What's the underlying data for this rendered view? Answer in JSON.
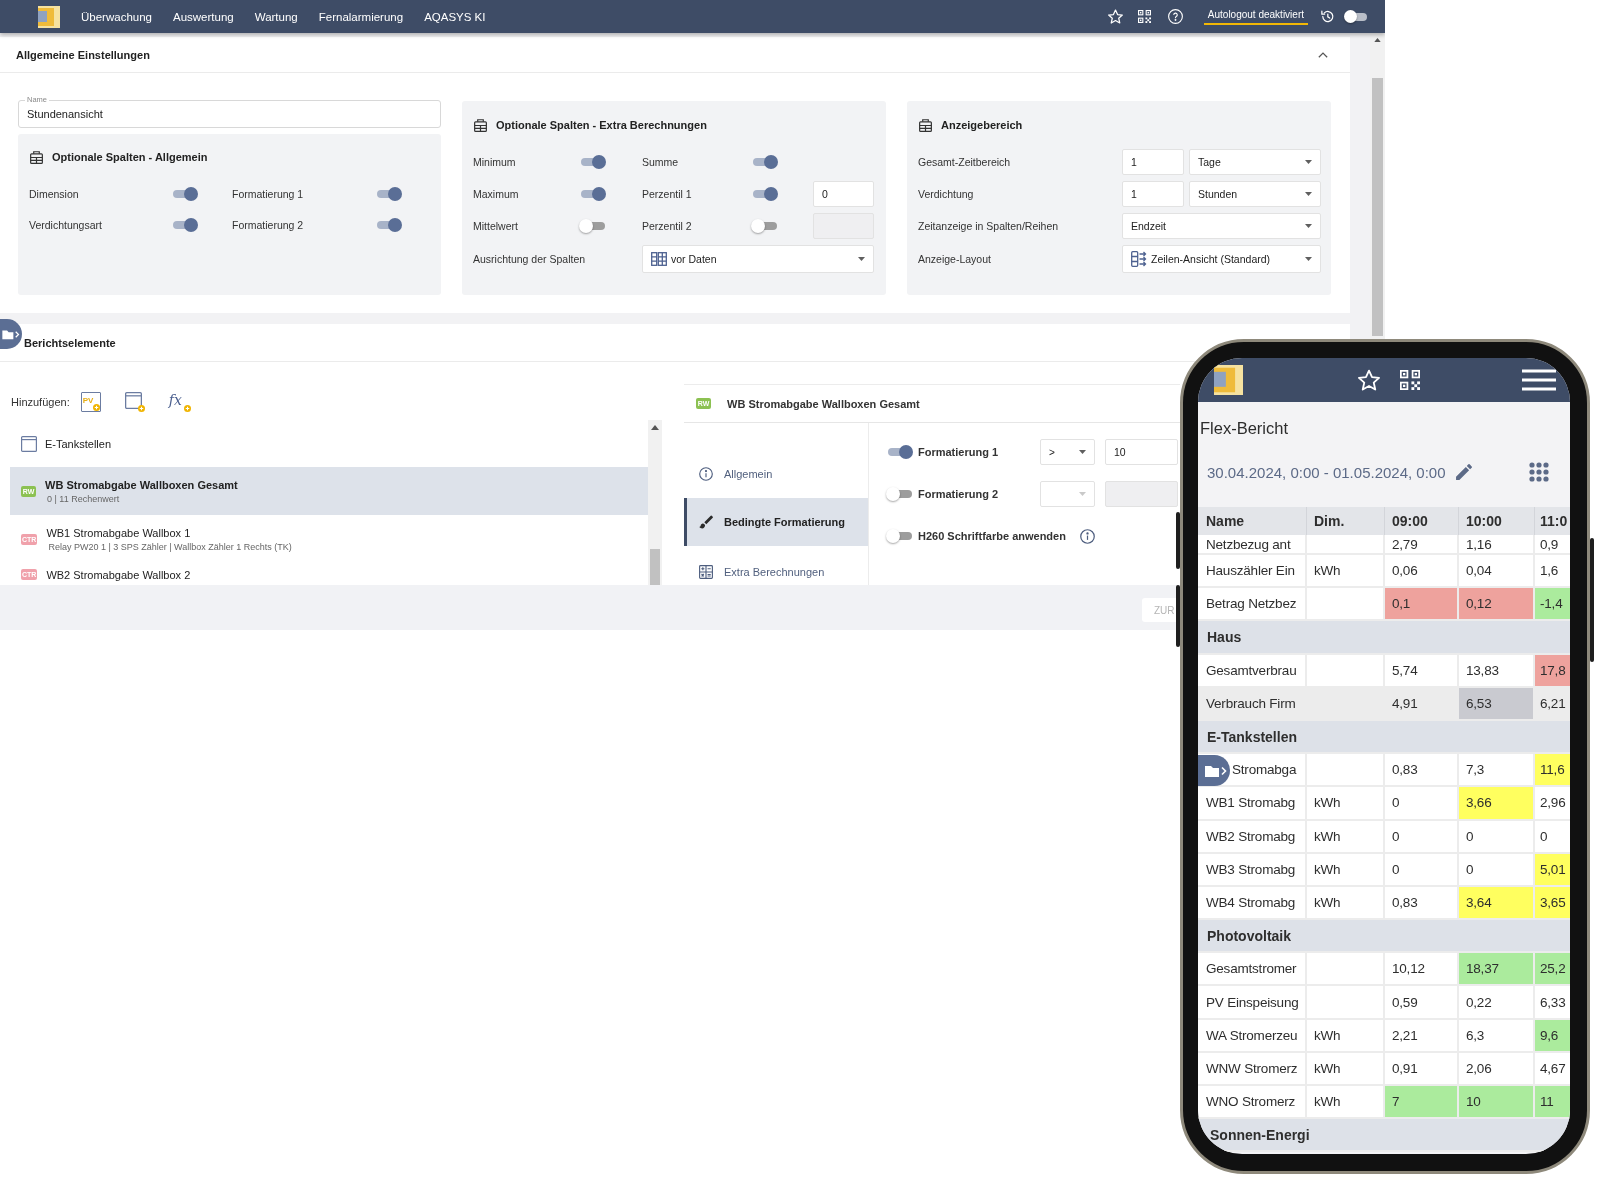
{
  "top_bar": {
    "nav": [
      "Überwachung",
      "Auswertung",
      "Wartung",
      "Fernalarmierung",
      "AQASYS KI"
    ],
    "autologout_label": "Autologout deaktiviert",
    "toggle_on": false
  },
  "general_settings": {
    "title": "Allgemeine Einstellungen",
    "expanded": true,
    "name_field": {
      "label": "Name",
      "value": "Stundenansicht"
    },
    "columns_panel": {
      "title": "Optionale Spalten - Allgemein",
      "toggles": [
        {
          "label": "Dimension",
          "on": true
        },
        {
          "label": "Formatierung 1",
          "on": true
        },
        {
          "label": "Verdichtungsart",
          "on": true
        },
        {
          "label": "Formatierung 2",
          "on": true
        }
      ]
    },
    "extra_panel": {
      "title": "Optionale Spalten - Extra Berechnungen",
      "toggles": [
        {
          "label": "Minimum",
          "on": true
        },
        {
          "label": "Summe",
          "on": true
        },
        {
          "label": "Maximum",
          "on": true
        },
        {
          "label": "Perzentil 1",
          "on": true,
          "input": {
            "value": "0",
            "disabled": false
          }
        },
        {
          "label": "Mittelwert",
          "on": false
        },
        {
          "label": "Perzentil 2",
          "on": false,
          "input": {
            "disabled": true
          }
        }
      ],
      "alignment": {
        "label": "Ausrichtung der Spalten",
        "value": "vor Daten"
      }
    },
    "display_panel": {
      "title": "Anzeigebereich",
      "rows": [
        {
          "kind": "amount",
          "label": "Gesamt-Zeitbereich",
          "amount": "1",
          "unit": "Tage"
        },
        {
          "kind": "amount",
          "label": "Verdichtung",
          "amount": "1",
          "unit": "Stunden"
        },
        {
          "kind": "select",
          "label": "Zeitanzeige in Spalten/Reihen",
          "value": "Endzeit"
        },
        {
          "kind": "layout",
          "label": "Anzeige-Layout",
          "value": "Zeilen-Ansicht (Standard)"
        }
      ]
    }
  },
  "report_elements": {
    "title": "Berichtselemente",
    "add_label": "Hinzufügen:",
    "add_buttons": [
      {
        "kind": "pv",
        "text": "PV"
      },
      {
        "kind": "group"
      },
      {
        "kind": "formula",
        "text": "fx"
      }
    ],
    "items": [
      {
        "kind": "group",
        "title": "E-Tankstellen",
        "selected": false
      },
      {
        "kind": "element",
        "badge": "RW",
        "color": "#8cc152",
        "title": "WB Stromabgabe Wallboxen Gesamt",
        "detail": "0 | 11 Rechenwert",
        "selected": true
      },
      {
        "kind": "element",
        "badge": "CTR",
        "color": "#f0a1ab",
        "title": "WB1 Stromabgabe Wallbox 1",
        "detail": "Relay PW20 1 | 3 SPS Zähler | Wallbox Zähler 1 Rechts (TK)",
        "selected": false
      },
      {
        "kind": "element",
        "badge": "CTR",
        "color": "#f0a1ab",
        "title": "WB2 Stromabgabe Wallbox 2",
        "selected": false
      }
    ],
    "detail": {
      "badge": "RW",
      "color": "#8cc152",
      "title": "WB Stromabgabe Wallboxen Gesamt",
      "nav": [
        {
          "kind": "info",
          "label": "Allgemein",
          "selected": false
        },
        {
          "kind": "brush",
          "label": "Bedingte Formatierung",
          "selected": true
        },
        {
          "kind": "calculator",
          "label": "Extra Berechnungen",
          "selected": false
        }
      ],
      "rules": [
        {
          "kind": "condition",
          "label": "Formatierung 1",
          "on": true,
          "operator": ">",
          "value": "10"
        },
        {
          "kind": "condition",
          "label": "Formatierung 2",
          "on": false
        },
        {
          "kind": "option",
          "label": "H260 Schriftfarbe anwenden",
          "on": false
        }
      ]
    },
    "footer_button": "ZUR"
  },
  "phone": {
    "title": "Flex-Bericht",
    "date_range": "30.04.2024, 0:00 - 01.05.2024, 0:00",
    "columns": [
      "Name",
      "Dim.",
      "09:00",
      "10:00",
      "11:0"
    ],
    "rows": [
      {
        "kind": "data",
        "name": "Netzbezug ant",
        "values": [
          {
            "text": "2,79"
          },
          {
            "text": "1,16"
          },
          {
            "text": "0,9"
          }
        ]
      },
      {
        "kind": "data",
        "name": "Hauszähler Ein",
        "dim": "kWh",
        "values": [
          {
            "text": "0,06"
          },
          {
            "text": "0,04"
          },
          {
            "text": "1,6"
          }
        ]
      },
      {
        "kind": "data",
        "name": "Betrag Netzbez",
        "values": [
          {
            "text": "0,1",
            "color": "#eea29d"
          },
          {
            "text": "0,12",
            "color": "#eea29d"
          },
          {
            "text": "-1,4",
            "color": "#abeb9d"
          }
        ]
      },
      {
        "kind": "group",
        "name": "Haus"
      },
      {
        "kind": "data",
        "name": "Gesamtverbrau",
        "values": [
          {
            "text": "5,74"
          },
          {
            "text": "13,83"
          },
          {
            "text": "17,8",
            "color": "#eea29d"
          }
        ]
      },
      {
        "kind": "data",
        "name": "Verbrauch Firm",
        "color": "#ececec",
        "values": [
          {
            "text": "4,91"
          },
          {
            "text": "6,53",
            "color": "#c9cad0"
          },
          {
            "text": "6,21"
          }
        ]
      },
      {
        "kind": "group",
        "name": "E-Tankstellen"
      },
      {
        "kind": "data",
        "name": "Stromabga",
        "values": [
          {
            "text": "0,83"
          },
          {
            "text": "7,3"
          },
          {
            "text": "11,6",
            "color": "#ffff5f"
          }
        ]
      },
      {
        "kind": "data",
        "name": "WB1 Stromabg",
        "dim": "kWh",
        "values": [
          {
            "text": "0"
          },
          {
            "text": "3,66",
            "color": "#ffff5f"
          },
          {
            "text": "2,96"
          }
        ]
      },
      {
        "kind": "data",
        "name": "WB2 Stromabg",
        "dim": "kWh",
        "values": [
          {
            "text": "0"
          },
          {
            "text": "0"
          },
          {
            "text": "0"
          }
        ]
      },
      {
        "kind": "data",
        "name": "WB3 Stromabg",
        "dim": "kWh",
        "values": [
          {
            "text": "0"
          },
          {
            "text": "0"
          },
          {
            "text": "5,01",
            "color": "#ffff5f"
          }
        ]
      },
      {
        "kind": "data",
        "name": "WB4 Stromabg",
        "dim": "kWh",
        "values": [
          {
            "text": "0,83"
          },
          {
            "text": "3,64",
            "color": "#ffff5f"
          },
          {
            "text": "3,65",
            "color": "#ffff5f"
          }
        ]
      },
      {
        "kind": "group",
        "name": "Photovoltaik"
      },
      {
        "kind": "data",
        "name": "Gesamtstromer",
        "values": [
          {
            "text": "10,12"
          },
          {
            "text": "18,37",
            "color": "#abeb9d"
          },
          {
            "text": "25,2",
            "color": "#abeb9d"
          }
        ]
      },
      {
        "kind": "data",
        "name": "PV Einspeisung",
        "values": [
          {
            "text": "0,59"
          },
          {
            "text": "0,22"
          },
          {
            "text": "6,33"
          }
        ]
      },
      {
        "kind": "data",
        "name": "WA Stromerzeu",
        "dim": "kWh",
        "values": [
          {
            "text": "2,21"
          },
          {
            "text": "6,3"
          },
          {
            "text": "9,6",
            "color": "#abeb9d"
          }
        ]
      },
      {
        "kind": "data",
        "name": "WNW Stromerz",
        "dim": "kWh",
        "values": [
          {
            "text": "0,91"
          },
          {
            "text": "2,06"
          },
          {
            "text": "4,67"
          }
        ]
      },
      {
        "kind": "data",
        "name": "WNO Stromerz",
        "dim": "kWh",
        "values": [
          {
            "text": "7",
            "color": "#abeb9d"
          },
          {
            "text": "10",
            "color": "#abeb9d"
          },
          {
            "text": "11",
            "color": "#abeb9d"
          }
        ]
      },
      {
        "kind": "group",
        "name": "Sonnen-Energi"
      }
    ]
  }
}
